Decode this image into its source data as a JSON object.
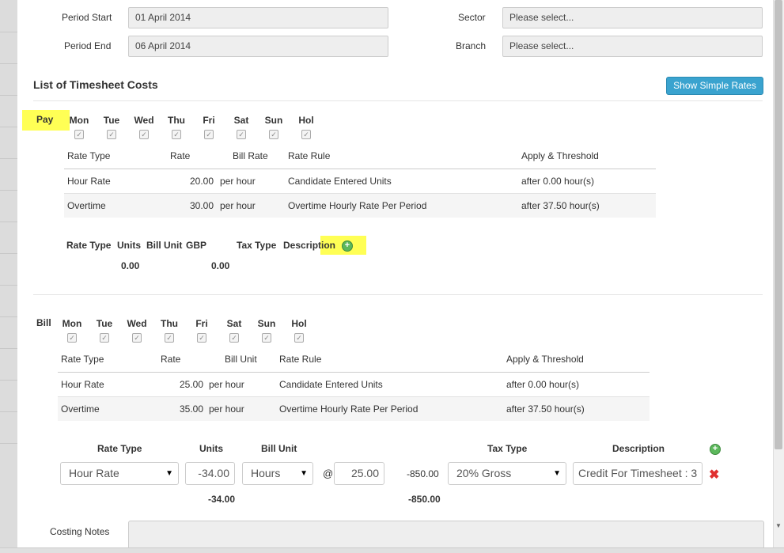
{
  "period": {
    "start_label": "Period Start",
    "start_value": "01 April 2014",
    "end_label": "Period End",
    "end_value": "06 April 2014",
    "sector_label": "Sector",
    "sector_value": "Please select...",
    "branch_label": "Branch",
    "branch_value": "Please select..."
  },
  "section_title": "List of Timesheet Costs",
  "show_simple_rates": "Show Simple Rates",
  "pay": {
    "label": "Pay",
    "days": [
      "Mon",
      "Tue",
      "Wed",
      "Thu",
      "Fri",
      "Sat",
      "Sun",
      "Hol"
    ],
    "headers": [
      "Rate Type",
      "Rate",
      "Bill Rate",
      "Rate Rule",
      "Apply & Threshold"
    ],
    "rows": [
      {
        "type": "Hour Rate",
        "rate": "20.00",
        "unit": "per hour",
        "rule": "Candidate Entered Units",
        "threshold": "after 0.00 hour(s)"
      },
      {
        "type": "Overtime",
        "rate": "30.00",
        "unit": "per hour",
        "rule": "Overtime Hourly Rate Per Period",
        "threshold": "after 37.50 hour(s)"
      }
    ],
    "costs_headers": [
      "Rate Type",
      "Units",
      "Bill Unit",
      "GBP",
      "Tax Type",
      "Description"
    ],
    "units_total": "0.00",
    "gbp_total": "0.00"
  },
  "bill": {
    "label": "Bill",
    "days": [
      "Mon",
      "Tue",
      "Wed",
      "Thu",
      "Fri",
      "Sat",
      "Sun",
      "Hol"
    ],
    "headers": [
      "Rate Type",
      "Rate",
      "Bill Unit",
      "Rate Rule",
      "Apply & Threshold"
    ],
    "rows": [
      {
        "type": "Hour Rate",
        "rate": "25.00",
        "unit": "per hour",
        "rule": "Candidate Entered Units",
        "threshold": "after 0.00 hour(s)"
      },
      {
        "type": "Overtime",
        "rate": "35.00",
        "unit": "per hour",
        "rule": "Overtime Hourly Rate Per Period",
        "threshold": "after 37.50 hour(s)"
      }
    ],
    "costs_headers": [
      "Rate Type",
      "Units",
      "Bill Unit",
      "Tax Type",
      "Description"
    ],
    "line": {
      "rate_type": "Hour Rate",
      "units": "-34.00",
      "bill_unit": "Hours",
      "at": "@",
      "rate": "25.00",
      "amount": "-850.00",
      "tax_type": "20% Gross",
      "description": "Credit For Timesheet : 3"
    },
    "units_total": "-34.00",
    "amount_total": "-850.00"
  },
  "costing_notes_label": "Costing Notes",
  "colors": {
    "highlight": "#ffff55",
    "accent": "#3aa3cf",
    "add": "#5cb85c",
    "delete": "#e03030"
  },
  "icons": {
    "add": "plus-circle-icon",
    "delete": "x-icon",
    "dropdown": "caret-down-icon",
    "checkbox": "checkmark-icon"
  }
}
